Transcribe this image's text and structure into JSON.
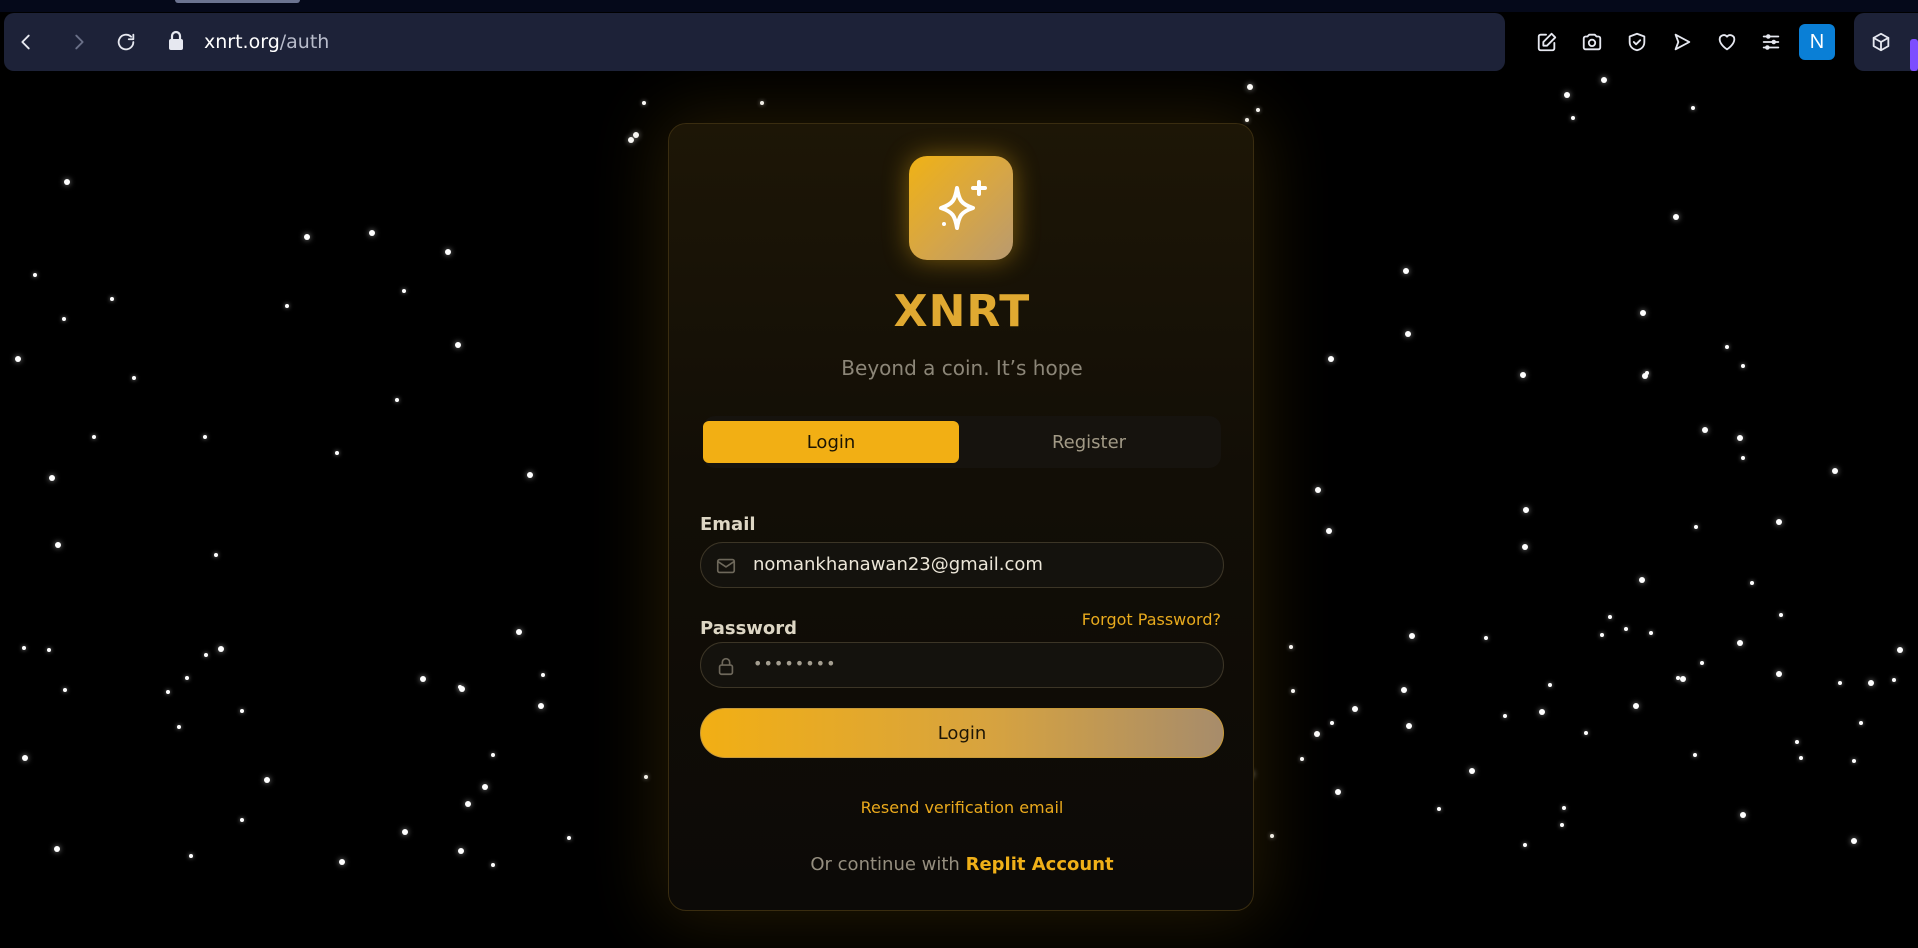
{
  "browser": {
    "url_host": "xnrt.org",
    "url_path": "/auth",
    "profile_initial": "N",
    "icons": [
      "back-icon",
      "forward-icon",
      "reload-icon",
      "lock-icon",
      "edit-icon",
      "camera-icon",
      "shield-check-icon",
      "send-icon",
      "heart-icon",
      "sliders-icon",
      "extensions-cube-icon"
    ]
  },
  "auth": {
    "brand": "XNRT",
    "tagline": "Beyond a coin. It’s hope",
    "tabs": {
      "login": "Login",
      "register": "Register"
    },
    "email_label": "Email",
    "email_value": "nomankhanawan23@gmail.com",
    "password_label": "Password",
    "forgot_label": "Forgot Password?",
    "password_mask": "••••••••",
    "login_button": "Login",
    "resend_label": "Resend verification email",
    "alt_prefix": "Or continue with ",
    "alt_provider": "Replit Account"
  },
  "colors": {
    "accent": "#f2af14",
    "brand_text": "#e0a931",
    "background": "#000000",
    "chrome": "#1d2238"
  }
}
